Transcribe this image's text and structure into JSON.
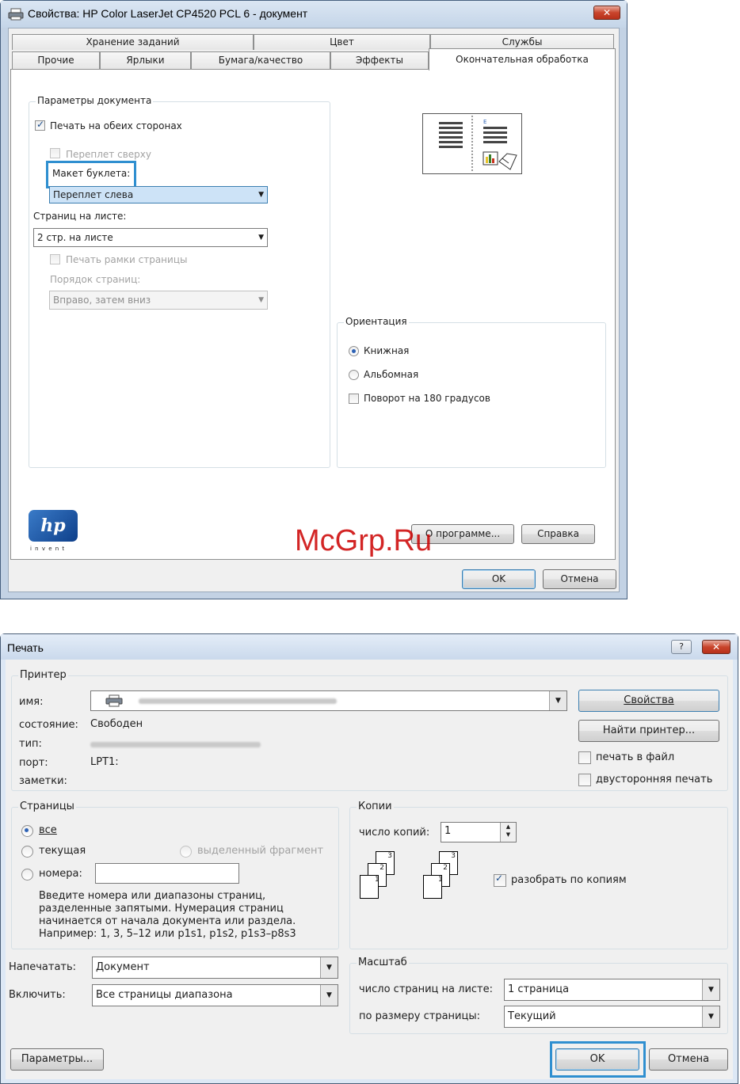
{
  "win1": {
    "title": "Свойства: HP Color LaserJet CP4520 PCL 6 - документ",
    "close": "✕",
    "tabs_back": [
      "Хранение заданий",
      "Цвет",
      "Службы"
    ],
    "tabs_front": [
      "Прочие",
      "Ярлыки",
      "Бумага/качество",
      "Эффекты",
      "Окончательная обработка"
    ],
    "doc_group": "Параметры документа",
    "duplex": "Печать на обеих сторонах",
    "flip": "Переплет сверху",
    "booklet_label": "Макет буклета:",
    "booklet_value": "Переплет слева",
    "pps_label": "Страниц на листе:",
    "pps_value": "2 стр. на листе",
    "borders": "Печать рамки страницы",
    "order_label": "Порядок страниц:",
    "order_value": "Вправо, затем вниз",
    "orient_group": "Ориентация",
    "portrait": "Книжная",
    "landscape": "Альбомная",
    "rotate": "Поворот на 180 градусов",
    "logo": "hp",
    "logo_sub": "i n v e n t",
    "about": "О программе...",
    "help": "Справка",
    "ok": "OK",
    "cancel": "Отмена"
  },
  "watermark": "McGrp.Ru",
  "win2": {
    "title": "Печать",
    "help": "?",
    "close": "✕",
    "printer_group": "Принтер",
    "name_label": "имя:",
    "status_label": "состояние:",
    "status_value": "Свободен",
    "type_label": "тип:",
    "port_label": "порт:",
    "port_value": "LPT1:",
    "notes_label": "заметки:",
    "properties": "Свойства",
    "find_printer": "Найти принтер...",
    "print_to_file": "печать в файл",
    "duplex": "двусторонняя печать",
    "pages_group": "Страницы",
    "all": "все",
    "current": "текущая",
    "selection": "выделенный фрагмент",
    "pages": "номера:",
    "hint": "Введите номера или диапазоны страниц, разделенные запятыми. Нумерация страниц начинается от начала документа или раздела. Например: 1, 3, 5–12 или p1s1, p1s2, p1s3–p8s3",
    "copies_group": "Копии",
    "copies_label": "число копий:",
    "copies_value": "1",
    "collate": "разобрать по копиям",
    "print_what_label": "Напечатать:",
    "print_what_value": "Документ",
    "include_label": "Включить:",
    "include_value": "Все страницы диапазона",
    "zoom_group": "Масштаб",
    "pps_label": "число страниц на листе:",
    "pps_value": "1 страница",
    "scale_label": "по размеру страницы:",
    "scale_value": "Текущий",
    "options": "Параметры...",
    "ok": "OK",
    "cancel": "Отмена",
    "page_nums": [
      "3",
      "2",
      "1"
    ]
  }
}
